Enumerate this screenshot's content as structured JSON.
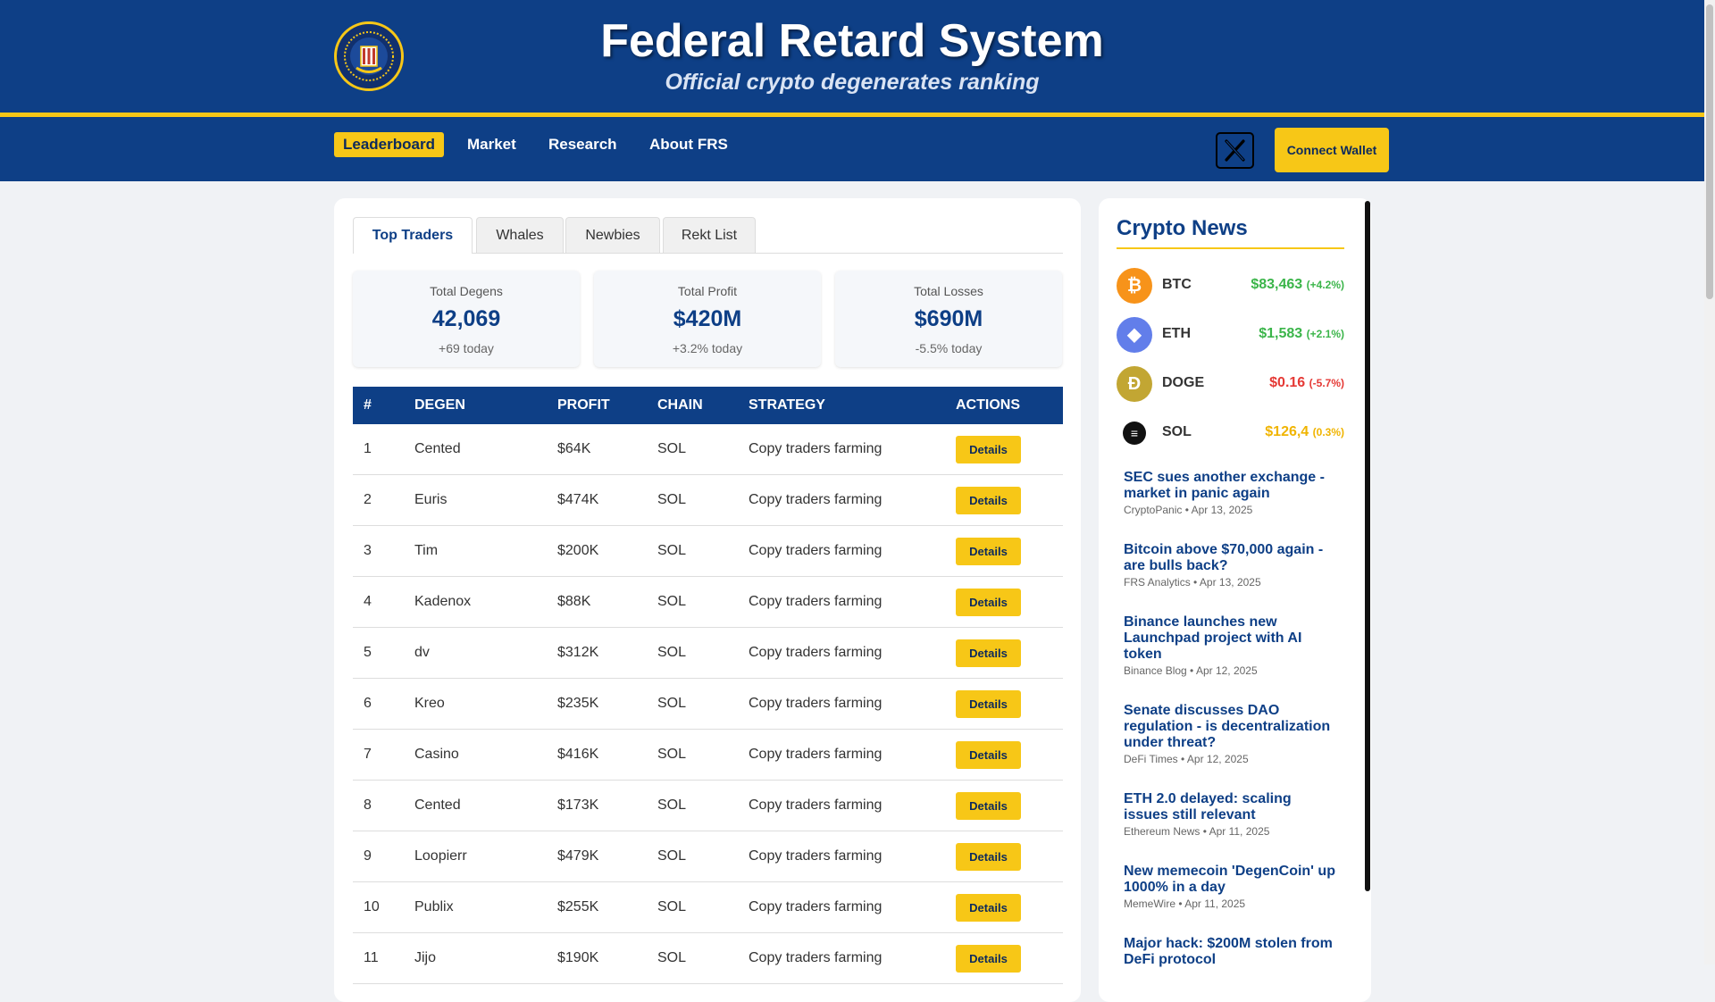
{
  "header": {
    "title": "Federal Retard System",
    "subtitle": "Official crypto degenerates ranking"
  },
  "nav": {
    "items": [
      "Leaderboard",
      "Market",
      "Research",
      "About FRS"
    ],
    "connect_wallet": "Connect Wallet"
  },
  "tabs": [
    "Top Traders",
    "Whales",
    "Newbies",
    "Rekt List"
  ],
  "stats": [
    {
      "label": "Total Degens",
      "value": "42,069",
      "change": "+69 today"
    },
    {
      "label": "Total Profit",
      "value": "$420M",
      "change": "+3.2% today"
    },
    {
      "label": "Total Losses",
      "value": "$690M",
      "change": "-5.5% today"
    }
  ],
  "table": {
    "headers": [
      "#",
      "DEGEN",
      "PROFIT",
      "CHAIN",
      "STRATEGY",
      "ACTIONS"
    ],
    "button_label": "Details",
    "rows": [
      {
        "rank": "1",
        "degen": "Cented",
        "profit": "$64K",
        "chain": "SOL",
        "strategy": "Copy traders farming"
      },
      {
        "rank": "2",
        "degen": "Euris",
        "profit": "$474K",
        "chain": "SOL",
        "strategy": "Copy traders farming"
      },
      {
        "rank": "3",
        "degen": "Tim",
        "profit": "$200K",
        "chain": "SOL",
        "strategy": "Copy traders farming"
      },
      {
        "rank": "4",
        "degen": "Kadenox",
        "profit": "$88K",
        "chain": "SOL",
        "strategy": "Copy traders farming"
      },
      {
        "rank": "5",
        "degen": "dv",
        "profit": "$312K",
        "chain": "SOL",
        "strategy": "Copy traders farming"
      },
      {
        "rank": "6",
        "degen": "Kreo",
        "profit": "$235K",
        "chain": "SOL",
        "strategy": "Copy traders farming"
      },
      {
        "rank": "7",
        "degen": "Casino",
        "profit": "$416K",
        "chain": "SOL",
        "strategy": "Copy traders farming"
      },
      {
        "rank": "8",
        "degen": "Cented",
        "profit": "$173K",
        "chain": "SOL",
        "strategy": "Copy traders farming"
      },
      {
        "rank": "9",
        "degen": "Loopierr",
        "profit": "$479K",
        "chain": "SOL",
        "strategy": "Copy traders farming"
      },
      {
        "rank": "10",
        "degen": "Publix",
        "profit": "$255K",
        "chain": "SOL",
        "strategy": "Copy traders farming"
      },
      {
        "rank": "11",
        "degen": "Jijo",
        "profit": "$190K",
        "chain": "SOL",
        "strategy": "Copy traders farming"
      }
    ]
  },
  "news": {
    "title": "Crypto News",
    "coins": [
      {
        "symbol": "BTC",
        "price": "$83,463",
        "change": "(+4.2%)",
        "trend": "up",
        "icon": "bitcoin-icon",
        "color": "#f7931a",
        "glyph": "₿"
      },
      {
        "symbol": "ETH",
        "price": "$1,583",
        "change": "(+2.1%)",
        "trend": "up",
        "icon": "ethereum-icon",
        "color": "#627eea",
        "glyph": "◆"
      },
      {
        "symbol": "DOGE",
        "price": "$0.16",
        "change": "(-5.7%)",
        "trend": "down",
        "icon": "dogecoin-icon",
        "color": "#c2a633",
        "glyph": "Ð"
      },
      {
        "symbol": "SOL",
        "price": "$126,4",
        "change": "(0.3%)",
        "trend": "neutral",
        "icon": "solana-icon",
        "color": "#111111",
        "glyph": "≡"
      }
    ],
    "articles": [
      {
        "headline": "SEC sues another exchange - market in panic again",
        "source": "CryptoPanic",
        "date": "Apr 13, 2025"
      },
      {
        "headline": "Bitcoin above $70,000 again - are bulls back?",
        "source": "FRS Analytics",
        "date": "Apr 13, 2025"
      },
      {
        "headline": "Binance launches new Launchpad project with AI token",
        "source": "Binance Blog",
        "date": "Apr 12, 2025"
      },
      {
        "headline": "Senate discusses DAO regulation - is decentralization under threat?",
        "source": "DeFi Times",
        "date": "Apr 12, 2025"
      },
      {
        "headline": "ETH 2.0 delayed: scaling issues still relevant",
        "source": "Ethereum News",
        "date": "Apr 11, 2025"
      },
      {
        "headline": "New memecoin 'DegenCoin' up 1000% in a day",
        "source": "MemeWire",
        "date": "Apr 11, 2025"
      },
      {
        "headline": "Major hack: $200M stolen from DeFi protocol",
        "source": "",
        "date": ""
      }
    ]
  },
  "colors": {
    "primary": "#0e3f86",
    "accent": "#f7c717",
    "up": "#3bb54a",
    "down": "#e53935",
    "neutral": "#f0b400"
  }
}
